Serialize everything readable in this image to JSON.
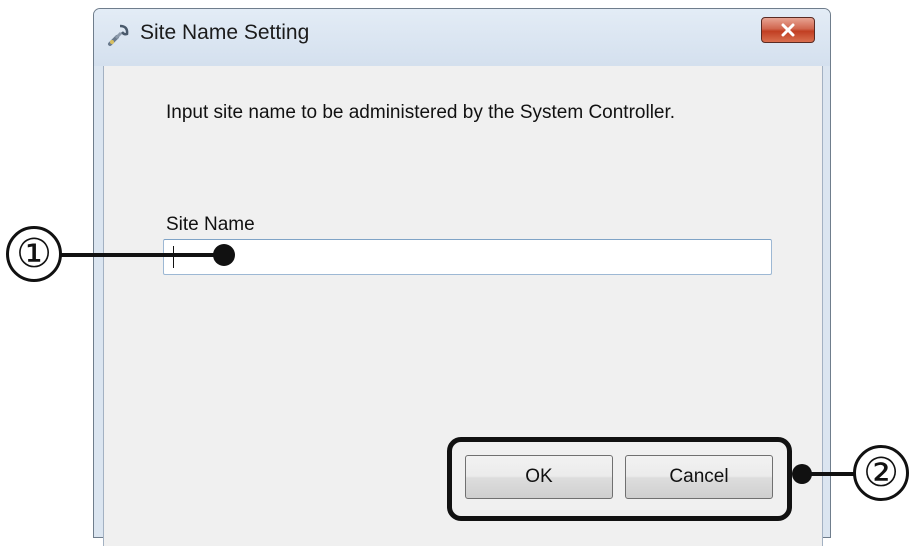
{
  "dialog": {
    "title": "Site Name Setting",
    "instruction": "Input site name to be administered by the System Controller.",
    "site_name_label": "Site Name",
    "site_name_value": "",
    "ok_label": "OK",
    "cancel_label": "Cancel"
  },
  "icons": {
    "app": "plug-wrench-icon",
    "close": "close-icon"
  },
  "callouts": {
    "one": "①",
    "two": "②"
  },
  "colors": {
    "close_button": "#c13e22",
    "window_frame": "#dbe5f0",
    "client_background": "#f0f0f0",
    "input_border": "#9db8d4"
  }
}
